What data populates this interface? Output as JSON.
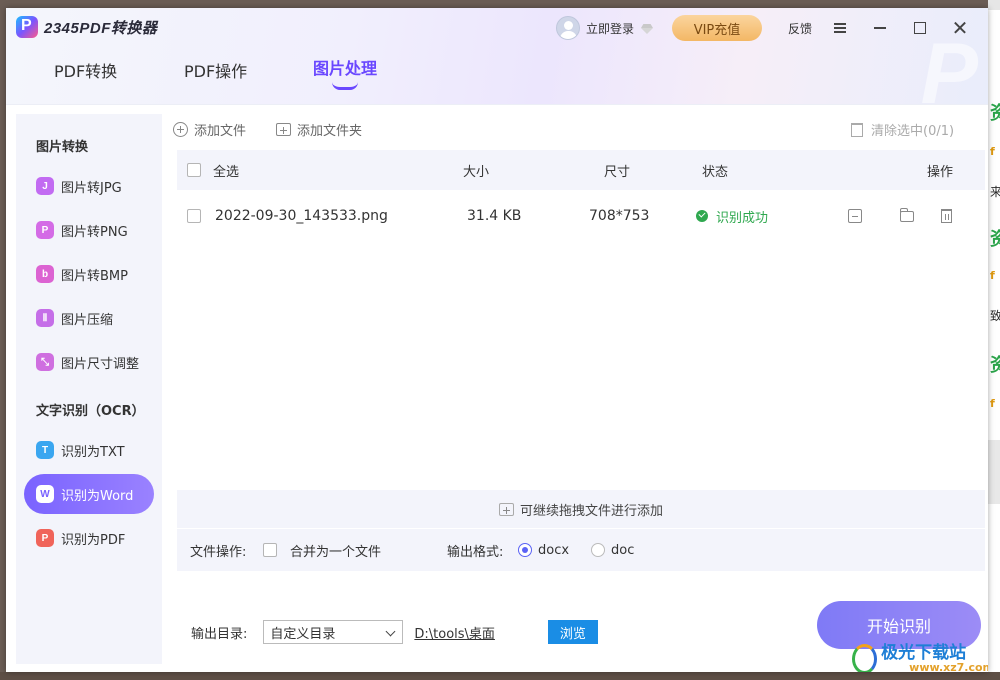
{
  "app": {
    "title": "2345PDF转换器",
    "login_label": "立即登录",
    "vip_label": "VIP充值",
    "feedback_label": "反馈",
    "watermark_letter": "P"
  },
  "tabs": [
    {
      "label": "PDF转换",
      "active": false
    },
    {
      "label": "PDF操作",
      "active": false
    },
    {
      "label": "图片处理",
      "active": true
    }
  ],
  "sidebar": {
    "groups": [
      {
        "title": "图片转换",
        "items": [
          {
            "label": "图片转JPG",
            "icon": "jpg-icon",
            "icon_char": "J",
            "color": "#c26bf2"
          },
          {
            "label": "图片转PNG",
            "icon": "png-icon",
            "icon_char": "P",
            "color": "#d46be6"
          },
          {
            "label": "图片转BMP",
            "icon": "bmp-icon",
            "icon_char": "b",
            "color": "#dc63d2"
          },
          {
            "label": "图片压缩",
            "icon": "compress-icon",
            "icon_char": "Ⅱ",
            "color": "#c56ee8"
          },
          {
            "label": "图片尺寸调整",
            "icon": "resize-icon",
            "icon_char": "⤡",
            "color": "#cf6fe0"
          }
        ]
      },
      {
        "title": "文字识别（OCR）",
        "items": [
          {
            "label": "识别为TXT",
            "icon": "txt-icon",
            "icon_char": "T",
            "color": "#3aa6f0"
          },
          {
            "label": "识别为Word",
            "icon": "word-icon",
            "icon_char": "W",
            "color": "#3f7cf2",
            "active": true
          },
          {
            "label": "识别为PDF",
            "icon": "pdf-icon",
            "icon_char": "P",
            "color": "#f0645a"
          }
        ]
      }
    ]
  },
  "toolbar": {
    "add_file": "添加文件",
    "add_folder": "添加文件夹",
    "clear_selected": "清除选中(0/1)"
  },
  "table": {
    "headers": {
      "select_all": "全选",
      "size": "大小",
      "dimension": "尺寸",
      "status": "状态",
      "actions": "操作"
    },
    "rows": [
      {
        "name": "2022-09-30_143533.png",
        "size": "31.4 KB",
        "dimension": "708*753",
        "status": "识别成功",
        "checked": false
      }
    ]
  },
  "drop_hint": "可继续拖拽文件进行添加",
  "options": {
    "file_op_label": "文件操作:",
    "merge_label": "合并为一个文件",
    "merge_checked": false,
    "format_label": "输出格式:",
    "formats": [
      {
        "label": "docx",
        "selected": true
      },
      {
        "label": "doc",
        "selected": false
      }
    ]
  },
  "output": {
    "dir_label": "输出目录:",
    "dir_mode": "自定义目录",
    "dir_path": "D:\\tools\\桌面",
    "browse_label": "浏览"
  },
  "start_label": "开始识别",
  "site_watermark": {
    "line1": "极光下载站",
    "line2": "www.xz7.com"
  },
  "colors": {
    "accent": "#6a48ff",
    "success": "#2fa84f",
    "browse": "#1a8de5"
  }
}
